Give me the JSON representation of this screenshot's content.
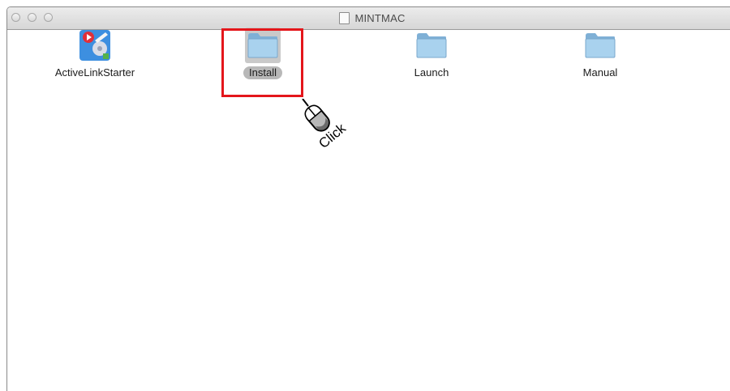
{
  "window": {
    "title": "MINTMAC"
  },
  "items": [
    {
      "label": "ActiveLinkStarter",
      "icon": "app-icon"
    },
    {
      "label": "Install",
      "icon": "folder-icon",
      "selected": true
    },
    {
      "label": "Launch",
      "icon": "folder-icon"
    },
    {
      "label": "Manual",
      "icon": "folder-icon"
    }
  ],
  "annotation": {
    "text": "Click",
    "highlight_color": "#e4161b"
  }
}
